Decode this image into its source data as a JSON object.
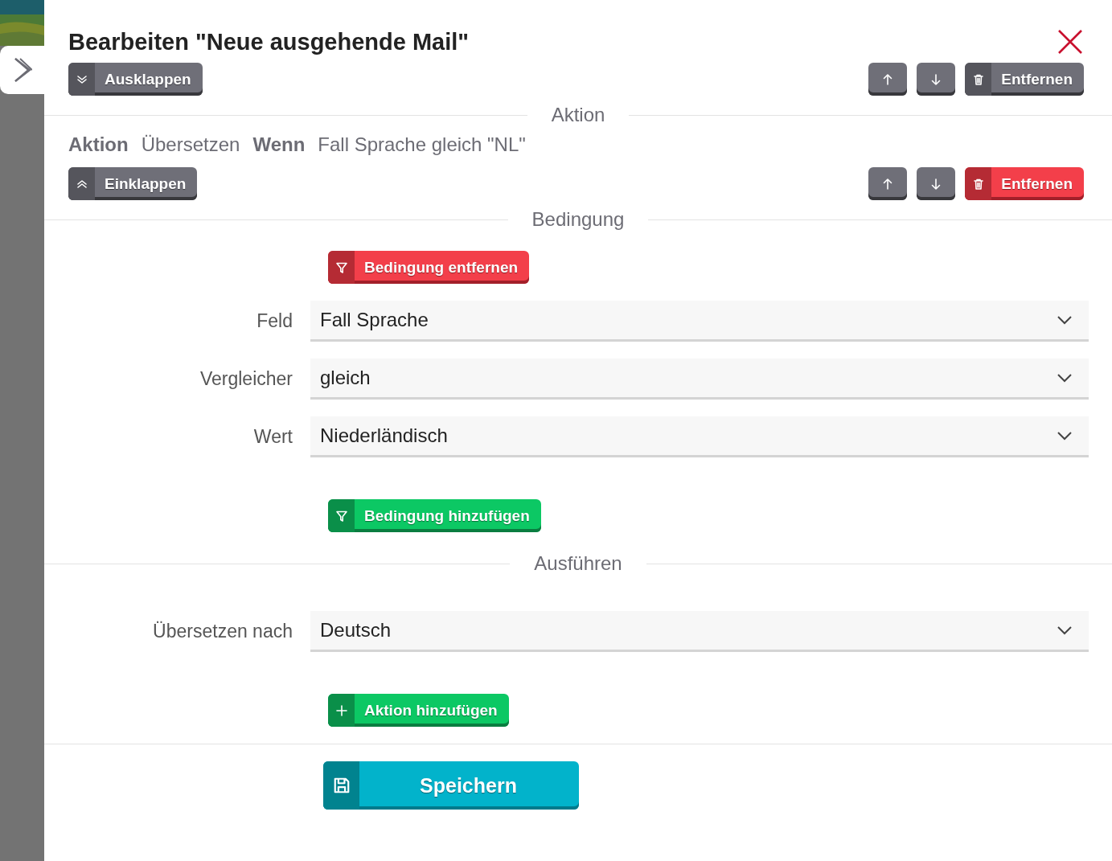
{
  "dialog": {
    "title": "Bearbeiten \"Neue ausgehende Mail\""
  },
  "rule_toolbar": {
    "toggle": {
      "label": "Ausklappen"
    },
    "remove": {
      "label": "Entfernen"
    }
  },
  "action_section": {
    "heading": "Aktion",
    "summary": [
      {
        "text": "Aktion",
        "kind": "keyword"
      },
      {
        "text": "Übersetzen",
        "kind": "value"
      },
      {
        "text": "Wenn",
        "kind": "keyword"
      },
      {
        "text": "Fall Sprache gleich \"NL\"",
        "kind": "value"
      }
    ],
    "toolbar": {
      "toggle": {
        "label": "Einklappen"
      },
      "remove": {
        "label": "Entfernen"
      }
    }
  },
  "condition_section": {
    "heading": "Bedingung",
    "remove_button": {
      "label": "Bedingung entfernen"
    },
    "fields": [
      {
        "label": "Feld",
        "value": "Fall Sprache"
      },
      {
        "label": "Vergleicher",
        "value": "gleich"
      },
      {
        "label": "Wert",
        "value": "Niederländisch"
      }
    ],
    "add_button": {
      "label": "Bedingung hinzufügen"
    }
  },
  "execute_section": {
    "heading": "Ausführen",
    "fields": [
      {
        "label": "Übersetzen nach",
        "value": "Deutsch"
      }
    ],
    "add_button": {
      "label": "Aktion hinzufügen"
    }
  },
  "save_button": {
    "label": "Speichern"
  }
}
